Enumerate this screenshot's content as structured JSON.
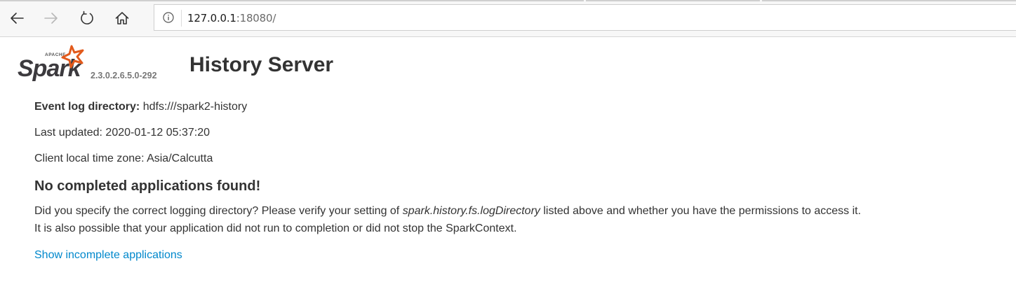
{
  "browser": {
    "url_host": "127.0.0.1",
    "url_rest": ":18080/",
    "icons": [
      "back-arrow-icon",
      "forward-arrow-icon",
      "refresh-icon",
      "home-icon",
      "info-icon"
    ]
  },
  "header": {
    "logo_alt": "Apache Spark",
    "logo_top_text": "APACHE",
    "logo_text": "Spark",
    "version": "2.3.0.2.6.5.0-292",
    "title": "History Server"
  },
  "info": {
    "event_log_label": "Event log directory:",
    "event_log_value": "hdfs:///spark2-history",
    "last_updated": "Last updated: 2020-01-12 05:37:20",
    "timezone": "Client local time zone: Asia/Calcutta"
  },
  "message": {
    "heading": "No completed applications found!",
    "line1_pre": "Did you specify the correct logging directory? Please verify your setting of ",
    "line1_code": "spark.history.fs.logDirectory",
    "line1_post": " listed above and whether you have the permissions to access it.",
    "line2": "It is also possible that your application did not run to completion or did not stop the SparkContext."
  },
  "link": {
    "incomplete": "Show incomplete applications"
  },
  "colors": {
    "link": "#0088cc",
    "spark_orange": "#e25a1c",
    "text": "#333333",
    "version": "#777777"
  }
}
